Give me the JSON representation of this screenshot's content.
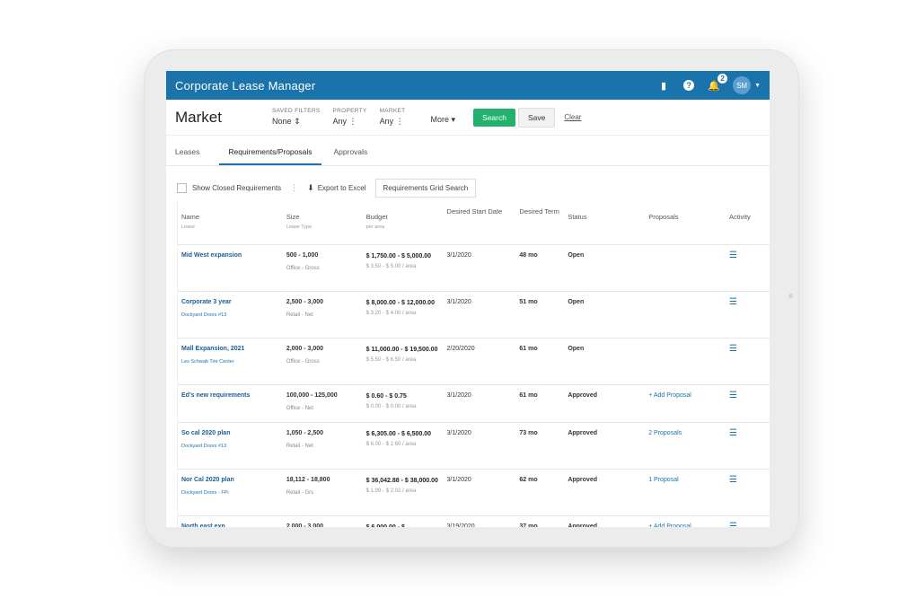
{
  "app": {
    "title": "Corporate Lease Manager",
    "user_initials": "SM",
    "notif_count": "2"
  },
  "icons": {
    "trash": "trash-icon",
    "help": "help-icon",
    "bell": "bell-icon",
    "caret": "caret-down-icon"
  },
  "colors": {
    "brand": "#1a73ab",
    "search": "#23b26d"
  },
  "filters": {
    "page_title": "Market",
    "saved": {
      "label": "SAVED FILTERS",
      "value": "None"
    },
    "property": {
      "label": "PROPERTY",
      "value": "Any"
    },
    "market": {
      "label": "MARKET",
      "value": "Any"
    },
    "more": "More",
    "search": "Search",
    "save": "Save",
    "clear": "Clear"
  },
  "tabs": [
    {
      "label": "Leases"
    },
    {
      "label": "Requirements/Proposals",
      "active": true
    },
    {
      "label": "Approvals"
    }
  ],
  "toolbar": {
    "show_closed": "Show Closed Requirements",
    "export": "Export to Excel",
    "grid_search": "Requirements Grid Search"
  },
  "table": {
    "headers": {
      "name": "Name",
      "name_sub": "Lease",
      "size": "Size",
      "size_sub": "Lease Type",
      "budget": "Budget",
      "budget_sub": "per area",
      "start": "Desired Start Date",
      "term": "Desired Term",
      "status": "Status",
      "proposals": "Proposals",
      "activity": "Activity"
    },
    "rows": [
      {
        "name": "Mid West expansion",
        "property": "",
        "size": "500 - 1,000",
        "type": "Office - Gross",
        "budget": "$ 1,750.00 - $ 5,000.00",
        "per_area": "$ 3.50 - $ 5.00 / area",
        "start": "3/1/2020",
        "term": "48 mo",
        "status": "Open",
        "proposals": ""
      },
      {
        "name": "Corporate 3 year",
        "property": "Dockyard Doors #13",
        "size": "2,500 - 3,000",
        "type": "Retail - Net",
        "budget": "$ 8,000.00 - $ 12,000.00",
        "per_area": "$ 3.20 - $ 4.00 / area",
        "start": "3/1/2020",
        "term": "51 mo",
        "status": "Open",
        "proposals": ""
      },
      {
        "name": "Mall Expansion, 2021",
        "property": "Les Schwab Tire Center",
        "size": "2,000 - 3,000",
        "type": "Office - Gross",
        "budget": "$ 11,000.00 - $ 19,500.00",
        "per_area": "$ 5.50 - $ 6.50 / area",
        "start": "2/20/2020",
        "term": "61 mo",
        "status": "Open",
        "proposals": ""
      },
      {
        "name": "Ed's new requirements",
        "property": "",
        "size": "100,000 - 125,000",
        "type": "Office - Net",
        "budget": "$ 0.60 - $ 0.75",
        "per_area": "$ 0.00 - $ 0.00 / area",
        "start": "3/1/2020",
        "term": "61 mo",
        "status": "Approved",
        "proposals": "+ Add Proposal"
      },
      {
        "name": "So cal 2020 plan",
        "property": "Dockyard Doors #13",
        "size": "1,050 - 2,500",
        "type": "Retail - Net",
        "budget": "$ 6,305.00 - $ 6,500.00",
        "per_area": "$ 6.00 - $ 2.60 / area",
        "start": "3/1/2020",
        "term": "73 mo",
        "status": "Approved",
        "proposals": "2 Proposals"
      },
      {
        "name": "Nor Cal 2020 plan",
        "property": "Dockyard Doors - FPi",
        "size": "18,112 - 18,800",
        "type": "Retail - Grs",
        "budget": "$ 36,042.88 - $ 38,000.00",
        "per_area": "$ 1.99 - $ 2.02 / area",
        "start": "3/1/2020",
        "term": "62 mo",
        "status": "Approved",
        "proposals": "1 Proposal"
      },
      {
        "name": "North east exp",
        "property": "",
        "size": "2,000 - 3,000",
        "type": "",
        "budget": "$ 6,000.00 - $",
        "per_area": "",
        "start": "3/19/2020",
        "term": "37 mo",
        "status": "Approved",
        "proposals": "+ Add Proposal"
      }
    ]
  }
}
